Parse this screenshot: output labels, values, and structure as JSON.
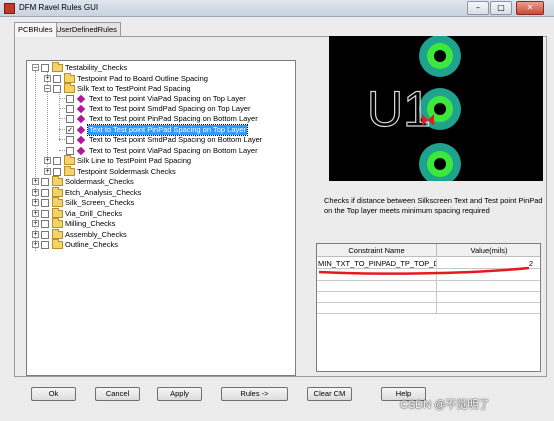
{
  "window": {
    "title": "DFM Ravel Rules GUI",
    "minimize": "–",
    "maximize": "□",
    "close": "✕"
  },
  "tabs": [
    {
      "label": "PCBRules",
      "active": true
    },
    {
      "label": "UserDefinedRules",
      "active": false
    }
  ],
  "tree": {
    "items": [
      {
        "label": "Testability_Checks",
        "expander": "–"
      },
      {
        "label": "Testpoint Pad to Board Outline Spacing",
        "expander": "+"
      },
      {
        "label": "Silk Text to TestPoint Pad Spacing",
        "expander": "–"
      },
      {
        "label": "Text to Test point ViaPad Spacing on Top Layer",
        "checked": false
      },
      {
        "label": "Text to Test point SmdPad Spacing on Top Layer",
        "checked": false
      },
      {
        "label": "Text to Test point PinPad Spacing on Bottom Layer",
        "checked": false
      },
      {
        "label": "Text to Test point PinPad Spacing on Top Layer",
        "checked": true,
        "selected": true
      },
      {
        "label": "Text to Test point SmdPad Spacing on Bottom Layer",
        "checked": false
      },
      {
        "label": "Text to Test point ViaPad Spacing on Bottom Layer",
        "checked": false
      },
      {
        "label": "Silk Line to TestPoint Pad Spacing",
        "expander": "+"
      },
      {
        "label": "Testpoint Soldermask Checks",
        "expander": "+"
      },
      {
        "label": "Soldermask_Checks",
        "expander": "+"
      },
      {
        "label": "Etch_Analysis_Checks",
        "expander": "+"
      },
      {
        "label": "Silk_Screen_Checks",
        "expander": "+"
      },
      {
        "label": "Via_Drill_Checks",
        "expander": "+"
      },
      {
        "label": "Milling_Checks",
        "expander": "+"
      },
      {
        "label": "Assembly_Checks",
        "expander": "+"
      },
      {
        "label": "Outline_Checks",
        "expander": "+"
      }
    ]
  },
  "preview": {
    "ref_text": "U1"
  },
  "description": "Checks if distance between Silkscreen Text and Test point PinPad on the Top layer meets minimum spacing required",
  "constraints": {
    "headers": [
      "Constraint Name",
      "Value(mils)"
    ],
    "rows": [
      {
        "name": "MIN_TXT_TO_PINPAD_TP_TOP_DIS",
        "value": "2"
      }
    ],
    "accent_color": "#e8191c"
  },
  "buttons": {
    "ok": "Ok",
    "cancel": "Cancel",
    "apply": "Apply",
    "rules": "Rules ->",
    "clear": "Clear CM",
    "help": "Help"
  },
  "watermark": "CSDN @不觉明了"
}
